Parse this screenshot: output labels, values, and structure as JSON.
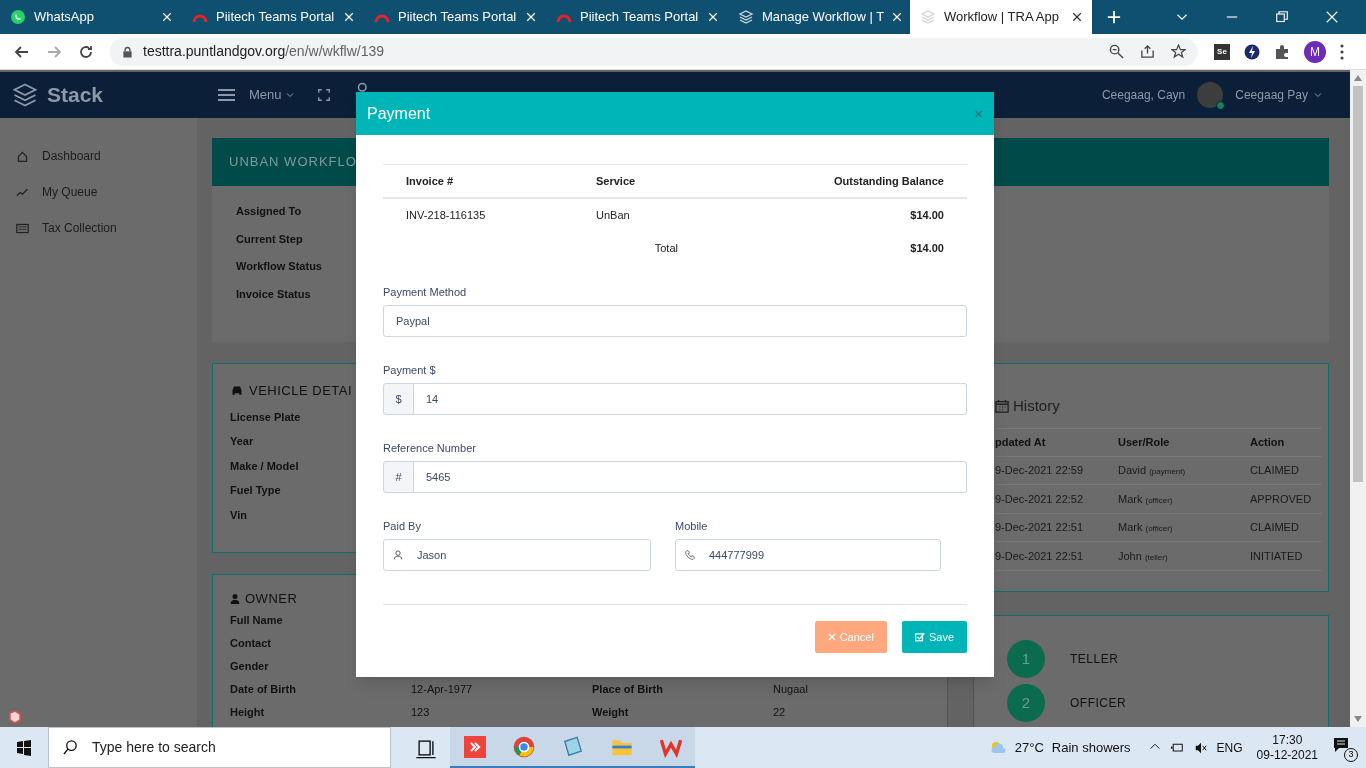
{
  "browser": {
    "tabs": [
      {
        "title": "WhatsApp",
        "kind": "chat",
        "selected": false
      },
      {
        "title": "Piitech Teams Portal",
        "kind": "portal",
        "selected": false
      },
      {
        "title": "Piitech Teams Portal",
        "kind": "portal",
        "selected": false
      },
      {
        "title": "Piitech Teams Portal",
        "kind": "portal",
        "selected": false
      },
      {
        "title": "Manage Workflow | T",
        "kind": "app",
        "selected": false
      },
      {
        "title": "Workflow | TRA App",
        "kind": "app",
        "selected": true
      }
    ],
    "url_host": "testtra.puntlandgov.org",
    "url_path": "/en/w/wkflw/139",
    "profile_initial": "M",
    "extension_label": "Se"
  },
  "app": {
    "brand": "Stack",
    "menu": "Menu",
    "user_name": "Ceegaag, Cayn",
    "user_role": "Ceegaag Pay",
    "sidebar": {
      "items": [
        {
          "label": "Dashboard",
          "kind": "home"
        },
        {
          "label": "My Queue",
          "kind": "queue"
        },
        {
          "label": "Tax Collection",
          "kind": "collection"
        }
      ]
    },
    "workflow_card": {
      "title": "UNBAN WORKFLO",
      "fields": [
        "Assigned To",
        "Current Step",
        "Workflow Status",
        "Invoice Status"
      ]
    },
    "vehicle_card": {
      "title": "VEHICLE DETAI",
      "fields": [
        "License Plate",
        "Year",
        "Make / Model",
        "Fuel Type",
        "Vin"
      ]
    },
    "owner_card": {
      "title": "OWNER",
      "rows": [
        {
          "label": "Full Name"
        },
        {
          "label": "Contact"
        },
        {
          "label": "Gender"
        },
        {
          "label": "Date of Birth",
          "value": "12-Apr-1977",
          "label_2": "Place of Birth",
          "value_2": "Nugaal"
        },
        {
          "label": "Height",
          "value": "123",
          "label_2": "Weight",
          "value_2": "22"
        }
      ]
    },
    "history": {
      "title": "History",
      "columns": [
        "pdated At",
        "User/Role",
        "Action"
      ],
      "rows": [
        {
          "time": "9-Dec-2021 22:59",
          "user": "David",
          "role": "(payment)",
          "action": "CLAIMED"
        },
        {
          "time": "9-Dec-2021 22:52",
          "user": "Mark",
          "role": "(officer)",
          "action": "APPROVED"
        },
        {
          "time": "9-Dec-2021 22:51",
          "user": "Mark",
          "role": "(officer)",
          "action": "CLAIMED"
        },
        {
          "time": "9-Dec-2021 22:51",
          "user": "John",
          "role": "(teller)",
          "action": "INITIATED"
        }
      ]
    },
    "steps": [
      {
        "number": "1",
        "label": "TELLER"
      },
      {
        "number": "2",
        "label": "OFFICER"
      }
    ]
  },
  "modal": {
    "title": "Payment",
    "close": "×",
    "table": {
      "columns": [
        "Invoice #",
        "Service",
        "Outstanding Balance"
      ],
      "rows": [
        {
          "invoice": "INV-218-116135",
          "service": "UnBan",
          "balance": "$14.00"
        }
      ],
      "total_label": "Total",
      "total_value": "$14.00"
    },
    "payment_method": {
      "label": "Payment Method",
      "value": "Paypal"
    },
    "payment": {
      "label": "Payment $",
      "addon": "$",
      "value": "14"
    },
    "reference": {
      "label": "Reference Number",
      "addon": "#",
      "value": "5465"
    },
    "paid_by": {
      "label": "Paid By",
      "value": "Jason"
    },
    "mobile": {
      "label": "Mobile",
      "value": "444777999"
    },
    "buttons": [
      {
        "label": "Cancel",
        "kind": "cancel"
      },
      {
        "label": "Save",
        "kind": "save"
      }
    ]
  },
  "taskbar": {
    "search_placeholder": "Type here to search",
    "temperature": "27°C",
    "weather": "Rain showers",
    "language": "ENG",
    "time": "17:30",
    "date": "09-12-2021",
    "notifications": "3"
  }
}
